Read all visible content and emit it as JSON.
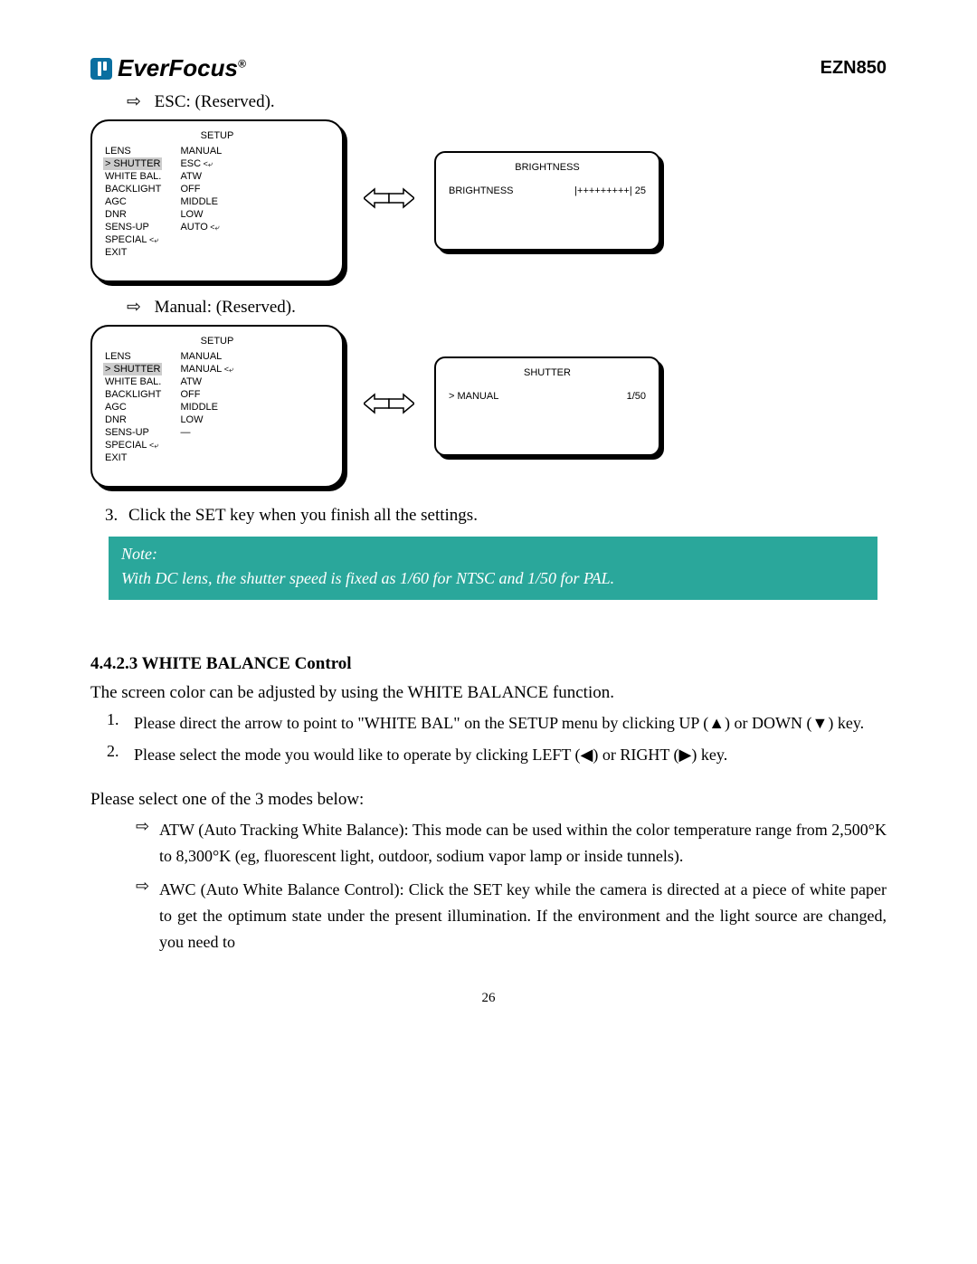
{
  "header": {
    "brand": "EverFocus",
    "model": "EZN850"
  },
  "esc_line": "ESC: (Reserved).",
  "manual_line": "Manual: (Reserved).",
  "menu": {
    "title": "SETUP",
    "left": [
      "LENS",
      "SHUTTER",
      "WHITE BAL.",
      "BACKLIGHT",
      "AGC",
      "DNR",
      "SENS-UP",
      "SPECIAL",
      "EXIT"
    ],
    "right_a": [
      "MANUAL",
      "ESC",
      "ATW",
      "OFF",
      "MIDDLE",
      "LOW",
      "AUTO"
    ],
    "right_b": [
      "MANUAL",
      "MANUAL",
      "ATW",
      "OFF",
      "MIDDLE",
      "LOW",
      "—"
    ]
  },
  "brightness": {
    "title": "BRIGHTNESS",
    "label": "BRIGHTNESS",
    "bar": "|+++++++++|",
    "value": "25"
  },
  "shutter": {
    "title": "SHUTTER",
    "label": "> MANUAL",
    "value": "1/50"
  },
  "step3": "Click the SET key when you finish all the settings.",
  "note": {
    "title": "Note:",
    "body": "With DC lens, the shutter speed is fixed as 1/60 for NTSC and 1/50 for PAL."
  },
  "section": {
    "heading": "4.4.2.3 WHITE BALANCE Control",
    "intro": "The screen color can be adjusted by using the WHITE BALANCE function.",
    "step1": "Please direct the arrow to point to \"WHITE BAL\" on the SETUP menu by clicking UP (▲) or DOWN (▼) key.",
    "step2": "Please select the mode you would like to operate by clicking LEFT (◀) or RIGHT (▶) key.",
    "select_intro": "Please select one of the 3 modes below:",
    "atw": "ATW (Auto Tracking White Balance): This mode can be used within the color temperature range from 2,500°K to 8,300°K (eg, fluorescent light, outdoor, sodium vapor lamp or inside tunnels).",
    "awc": "AWC (Auto White Balance Control): Click the SET key while the camera is directed at a piece of white paper to get the optimum state under the present illumination. If the environment and the light source are changed, you need to"
  },
  "page": "26"
}
